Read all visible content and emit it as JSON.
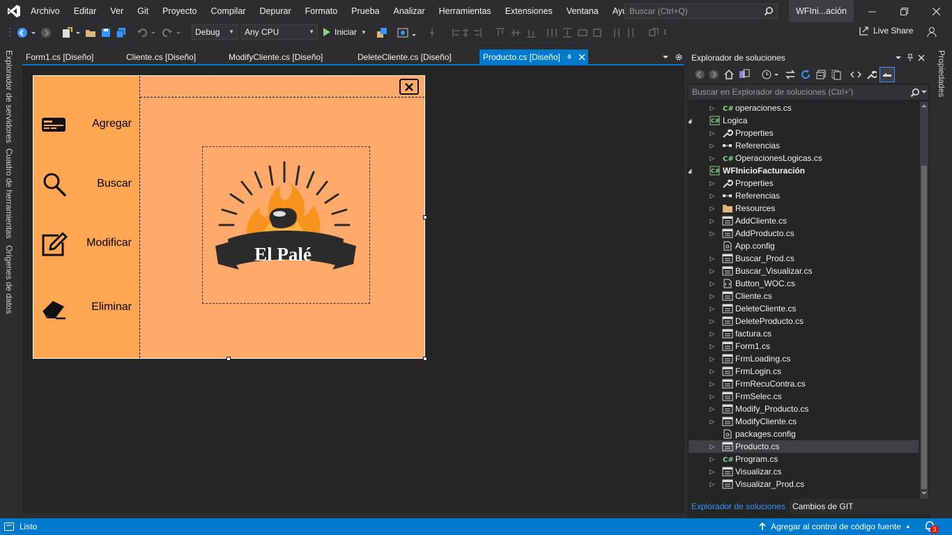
{
  "menu": {
    "items": [
      "Archivo",
      "Editar",
      "Ver",
      "Git",
      "Proyecto",
      "Compilar",
      "Depurar",
      "Formato",
      "Prueba",
      "Analizar",
      "Herramientas",
      "Extensiones",
      "Ventana",
      "Ayuda"
    ],
    "search_placeholder": "Buscar (Ctrl+Q)",
    "project_title": "WFIni...ación"
  },
  "toolbar": {
    "configuration": "Debug",
    "platform": "Any CPU",
    "start_label": "Iniciar",
    "live_share": "Live Share"
  },
  "left_strip": {
    "tabs": [
      "Explorador de servidores",
      "Cuadro de herramientas",
      "Orígenes de datos"
    ]
  },
  "document_tabs": [
    {
      "label": "Form1.cs [Diseño]"
    },
    {
      "label": "Cliente.cs [Diseño]"
    },
    {
      "label": "ModifyCliente.cs [Diseño]"
    },
    {
      "label": "DeleteCliente.cs [Diseño]"
    },
    {
      "label": "Producto.cs [Diseño]",
      "active": true
    }
  ],
  "form": {
    "buttons": [
      "Agregar",
      "Buscar",
      "Modificar",
      "Eliminar"
    ],
    "logo_text": "El Palé",
    "colors": {
      "background": "#ffa96a",
      "sidebar": "#ffa652",
      "flame": "#f7931e",
      "banner": "#2b2b2b"
    }
  },
  "solution_explorer": {
    "title": "Explorador de soluciones",
    "search_placeholder": "Buscar en Explorador de soluciones (Ctrl+')",
    "tree": [
      {
        "label": "operaciones.cs",
        "icon": "csharp-file",
        "expanded": false
      },
      {
        "label": "Logica",
        "icon": "csharp-project",
        "expanded": true
      },
      {
        "label": "Properties",
        "icon": "wrench",
        "expanded": false
      },
      {
        "label": "Referencias",
        "icon": "references",
        "expanded": false
      },
      {
        "label": "OperacionesLogicas.cs",
        "icon": "csharp-file",
        "expanded": false
      },
      {
        "label": "WFInicioFacturación",
        "icon": "csharp-project",
        "expanded": true,
        "bold": true
      },
      {
        "label": "Properties",
        "icon": "wrench",
        "expanded": false
      },
      {
        "label": "Referencias",
        "icon": "references",
        "expanded": false
      },
      {
        "label": "Resources",
        "icon": "folder",
        "expanded": false
      },
      {
        "label": "AddCliente.cs",
        "icon": "form",
        "expanded": false
      },
      {
        "label": "AddProducto.cs",
        "icon": "form",
        "expanded": false
      },
      {
        "label": "App.config",
        "icon": "config",
        "expanded": null
      },
      {
        "label": "Buscar_Prod.cs",
        "icon": "form",
        "expanded": false
      },
      {
        "label": "Buscar_Visualizar.cs",
        "icon": "form",
        "expanded": false
      },
      {
        "label": "Button_WOC.cs",
        "icon": "code-file",
        "expanded": false
      },
      {
        "label": "Cliente.cs",
        "icon": "form",
        "expanded": false
      },
      {
        "label": "DeleteCliente.cs",
        "icon": "form",
        "expanded": false
      },
      {
        "label": "DeleteProducto.cs",
        "icon": "form",
        "expanded": false
      },
      {
        "label": "factura.cs",
        "icon": "form",
        "expanded": false
      },
      {
        "label": "Form1.cs",
        "icon": "form",
        "expanded": false
      },
      {
        "label": "FrmLoading.cs",
        "icon": "form",
        "expanded": false
      },
      {
        "label": "FrmLogin.cs",
        "icon": "form",
        "expanded": false
      },
      {
        "label": "FrmRecuContra.cs",
        "icon": "form",
        "expanded": false
      },
      {
        "label": "FrmSelec.cs",
        "icon": "form",
        "expanded": false
      },
      {
        "label": "Modify_Producto.cs",
        "icon": "form",
        "expanded": false
      },
      {
        "label": "ModifyCliente.cs",
        "icon": "form",
        "expanded": false
      },
      {
        "label": "packages.config",
        "icon": "config",
        "expanded": null
      },
      {
        "label": "Producto.cs",
        "icon": "form",
        "expanded": false,
        "selected": true
      },
      {
        "label": "Program.cs",
        "icon": "csharp-file",
        "expanded": false
      },
      {
        "label": "Visualizar.cs",
        "icon": "form",
        "expanded": false
      },
      {
        "label": "Visualizar_Prod.cs",
        "icon": "form",
        "expanded": false
      }
    ],
    "bottom_tabs": [
      "Explorador de soluciones",
      "Cambios de GIT"
    ]
  },
  "right_strip": {
    "tab": "Propiedades"
  },
  "status": {
    "text": "Listo",
    "source_control": "Agregar al control de código fuente",
    "notifications": "3"
  }
}
